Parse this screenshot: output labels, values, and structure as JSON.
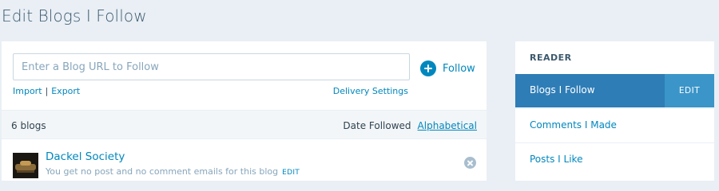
{
  "page": {
    "title": "Edit Blogs I Follow"
  },
  "follow": {
    "input_placeholder": "Enter a Blog URL to Follow",
    "button_label": "Follow",
    "import_label": "Import",
    "separator": "|",
    "export_label": "Export",
    "delivery_label": "Delivery Settings"
  },
  "list": {
    "count_label": "6 blogs",
    "sort_date_label": "Date Followed",
    "sort_alpha_label": "Alphabetical",
    "sort_selected": "Alphabetical",
    "blogs": [
      {
        "name": "Dackel Society",
        "subtitle": "You get no post and no comment emails for this blog",
        "edit_label": "EDIT"
      }
    ]
  },
  "sidebar": {
    "heading": "READER",
    "items": [
      {
        "label": "Blogs I Follow",
        "active": true,
        "edit_label": "EDIT"
      },
      {
        "label": "Comments I Made",
        "active": false
      },
      {
        "label": "Posts I Like",
        "active": false
      }
    ]
  },
  "colors": {
    "accent": "#0087be",
    "active_bg": "#2e7db6",
    "page_bg": "#e9eff5"
  }
}
